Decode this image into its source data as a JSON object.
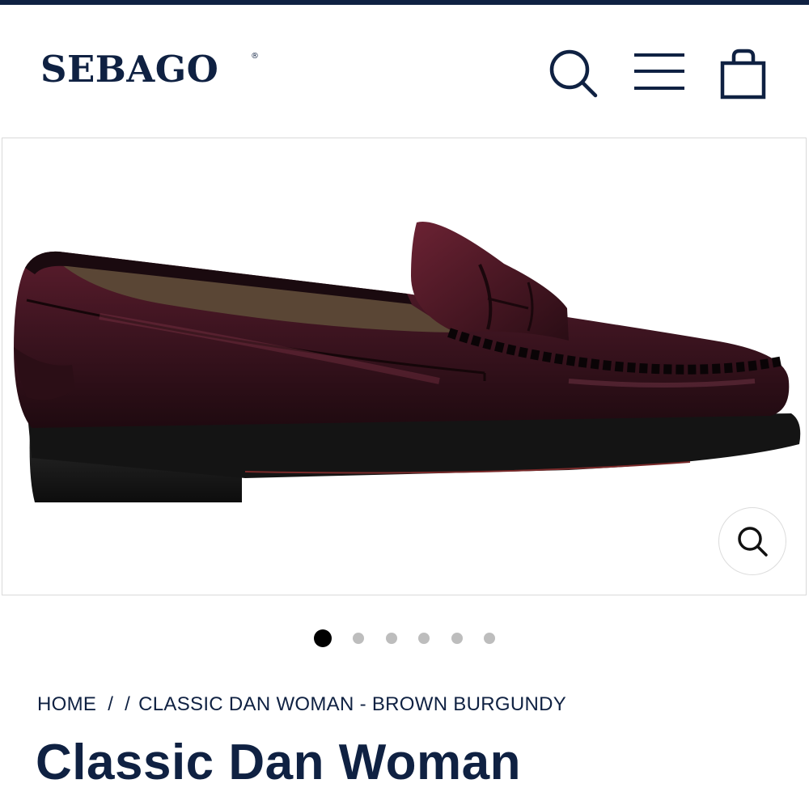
{
  "brand": {
    "logo_text": "SEBAGO",
    "registered_mark": "®",
    "color": "#0f2142"
  },
  "header": {
    "icons": [
      "search-icon",
      "menu-icon",
      "shopping-bag-icon"
    ]
  },
  "gallery": {
    "image_subject": "burgundy leather penny loafer",
    "total_images": 6,
    "active_index": 0,
    "zoom_icon": "zoom-icon"
  },
  "breadcrumb": {
    "home": "HOME",
    "sep1": "/",
    "sep2": "/",
    "current": "CLASSIC DAN WOMAN - BROWN BURGUNDY"
  },
  "product": {
    "title": "Classic Dan Woman"
  }
}
